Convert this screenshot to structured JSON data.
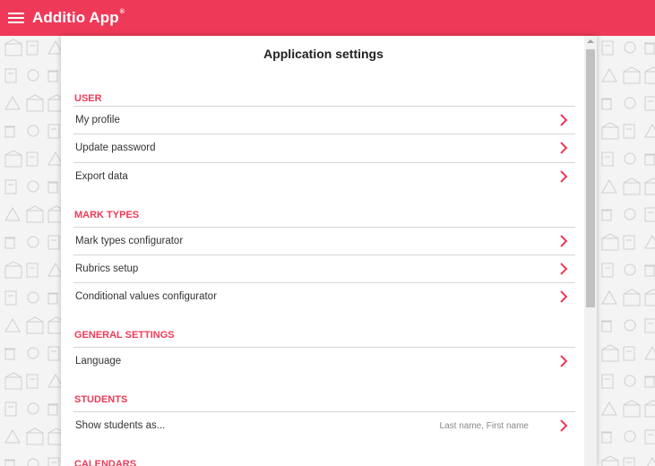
{
  "app": {
    "name": "Additio App",
    "trademark": "®"
  },
  "icons": {
    "menu": "hamburger-icon",
    "chevron": "chevron-right-icon"
  },
  "colors": {
    "brand": "#ee3a58",
    "text": "#333333",
    "muted": "#888888"
  },
  "settings": {
    "title": "Application settings",
    "sections": {
      "user": {
        "header": "USER",
        "my_profile": "My profile",
        "update_password": "Update password",
        "export_data": "Export data"
      },
      "mark_types": {
        "header": "MARK TYPES",
        "configurator": "Mark types configurator",
        "rubrics": "Rubrics setup",
        "conditional": "Conditional values configurator"
      },
      "general": {
        "header": "GENERAL SETTINGS",
        "language": "Language"
      },
      "students": {
        "header": "STUDENTS",
        "show_as": "Show students as...",
        "show_as_value": "Last name, First name"
      },
      "calendars": {
        "header": "CALENDARS"
      }
    }
  }
}
